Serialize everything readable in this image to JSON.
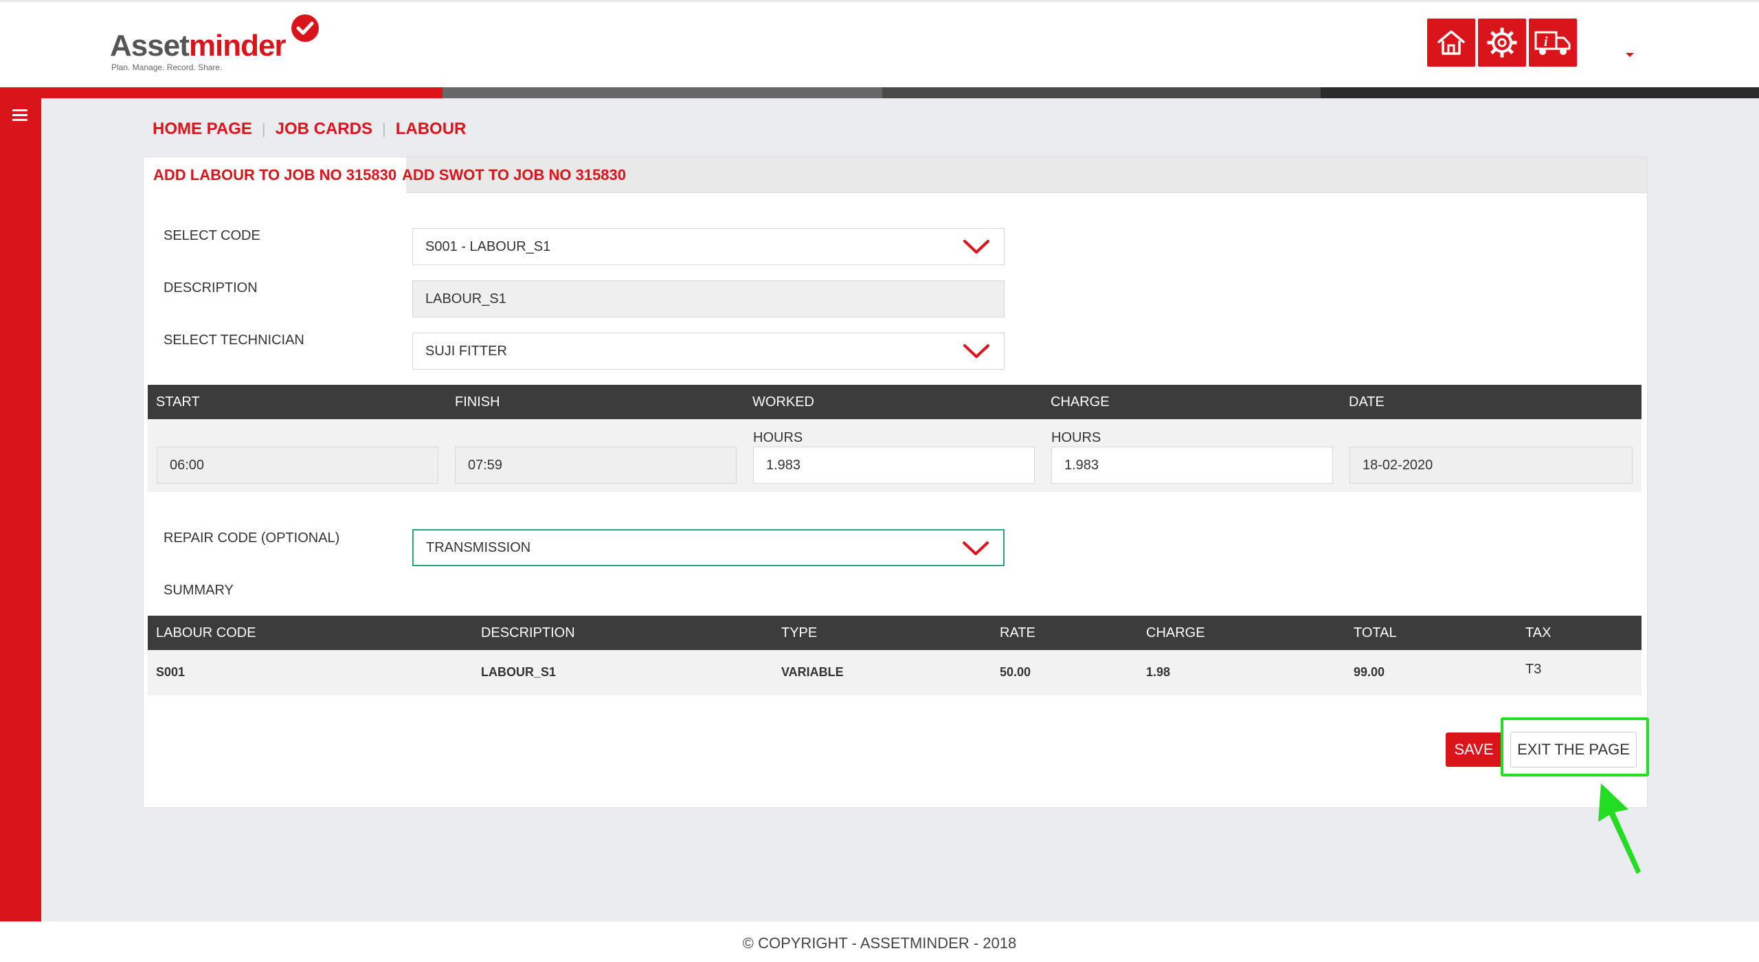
{
  "header": {
    "logo_main_1": "Asset",
    "logo_main_2": "minder",
    "logo_tagline": "Plan. Manage. Record. Share.",
    "icons": [
      "home-icon",
      "settings-icon",
      "truck-info-icon"
    ]
  },
  "colors": {
    "brand": "#d9141a",
    "dark": "#3c3c3c",
    "highlight": "#22dd22",
    "focus": "#2aa672"
  },
  "breadcrumb": {
    "home": "HOME PAGE",
    "job_cards": "JOB CARDS",
    "labour": "LABOUR",
    "separator": "|"
  },
  "tabs": {
    "add_labour": "ADD LABOUR TO JOB NO 315830",
    "add_swot": "ADD SWOT TO JOB NO 315830"
  },
  "form": {
    "select_code_label": "SELECT CODE",
    "select_code_value": "S001 - LABOUR_S1",
    "description_label": "DESCRIPTION",
    "description_value": "LABOUR_S1",
    "technician_label": "SELECT TECHNICIAN",
    "technician_value": "SUJI FITTER",
    "repair_code_label": "REPAIR CODE (OPTIONAL)",
    "repair_code_value": "TRANSMISSION",
    "summary_label": "SUMMARY"
  },
  "time_table": {
    "headers": [
      "START",
      "FINISH",
      "WORKED",
      "CHARGE",
      "DATE"
    ],
    "worked_sublabel": "HOURS",
    "charge_sublabel": "HOURS",
    "start": "06:00",
    "finish": "07:59",
    "worked": "1.983",
    "charge": "1.983",
    "date": "18-02-2020"
  },
  "summary_table": {
    "headers": [
      "LABOUR CODE",
      "DESCRIPTION",
      "TYPE",
      "RATE",
      "CHARGE",
      "TOTAL",
      "TAX"
    ],
    "rows": [
      [
        "S001",
        "LABOUR_S1",
        "VARIABLE",
        "50.00",
        "1.98",
        "99.00",
        "T3"
      ]
    ]
  },
  "buttons": {
    "save": "SAVE",
    "exit": "EXIT THE PAGE"
  },
  "footer": {
    "copyright": "© COPYRIGHT - ASSETMINDER - 2018"
  }
}
